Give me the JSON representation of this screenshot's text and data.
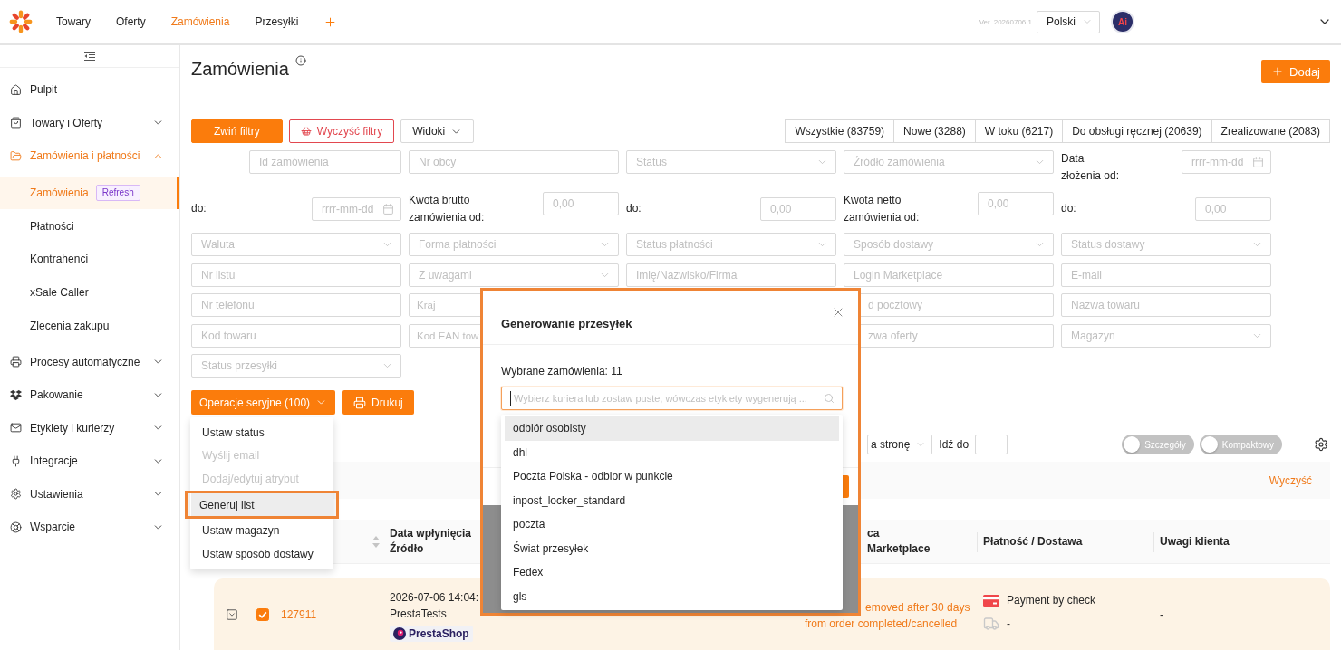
{
  "header": {
    "nav": [
      {
        "label": "Towary",
        "selected": false
      },
      {
        "label": "Oferty",
        "selected": false
      },
      {
        "label": "Zamówienia",
        "selected": true
      },
      {
        "label": "Przesyłki",
        "selected": false
      }
    ],
    "version": "Ver. 20260706.1",
    "language": "Polski",
    "avatar": "Ai"
  },
  "sidebar": {
    "items": [
      {
        "kind": "link",
        "label": "Pulpit"
      },
      {
        "kind": "group",
        "label": "Towary i Oferty",
        "expanded": false
      },
      {
        "kind": "group",
        "label": "Zamówienia i płatności",
        "expanded": true,
        "children": [
          {
            "label": "Zamówienia",
            "selected": true,
            "badge": "Refresh"
          },
          {
            "label": "Płatności",
            "selected": false
          },
          {
            "label": "Kontrahenci",
            "selected": false
          },
          {
            "label": "xSale Caller",
            "selected": false
          },
          {
            "label": "Zlecenia zakupu",
            "selected": false
          }
        ]
      },
      {
        "kind": "group",
        "label": "Procesy automatyczne",
        "expanded": false
      },
      {
        "kind": "group",
        "label": "Pakowanie",
        "expanded": false
      },
      {
        "kind": "group",
        "label": "Etykiety i kurierzy",
        "expanded": false
      },
      {
        "kind": "group",
        "label": "Integracje",
        "expanded": false
      },
      {
        "kind": "group",
        "label": "Ustawienia",
        "expanded": false
      },
      {
        "kind": "group",
        "label": "Wsparcie",
        "expanded": false
      }
    ]
  },
  "page": {
    "title": "Zamówienia",
    "add_button": "Dodaj"
  },
  "toolbar": {
    "buttons": [
      {
        "kind": "primary",
        "label": "Zwiń filtry"
      },
      {
        "kind": "danger",
        "label": "Wyczyść filtry"
      },
      {
        "kind": "dropdown",
        "label": "Widoki"
      }
    ],
    "status_tabs": [
      {
        "label": "Wszystkie (83759)",
        "selected": false
      },
      {
        "label": "Nowe (3288)",
        "selected": false
      },
      {
        "label": "W toku (6217)",
        "selected": false
      },
      {
        "label": "Do obsługi ręcznej (20639)",
        "selected": false
      },
      {
        "label": "Zrealizowane (2083)",
        "selected": false
      }
    ]
  },
  "filters": [
    {
      "kind": "input",
      "placeholder": "Id zamówienia"
    },
    {
      "kind": "input",
      "placeholder": "Nr obcy"
    },
    {
      "kind": "select",
      "placeholder": "Status"
    },
    {
      "kind": "select",
      "placeholder": "Źródło zamówienia"
    },
    {
      "kind": "date",
      "label": "Data złożenia od:",
      "placeholder": "rrrr-mm-dd"
    },
    {
      "kind": "date",
      "label": "do:",
      "placeholder": "rrrr-mm-dd"
    },
    {
      "kind": "number",
      "label": "Kwota brutto zamówienia od:",
      "placeholder": "0,00"
    },
    {
      "kind": "number",
      "label": "do:",
      "placeholder": "0,00"
    },
    {
      "kind": "number",
      "label": "Kwota netto zamówienia od:",
      "placeholder": "0,00"
    },
    {
      "kind": "number",
      "label": "do:",
      "placeholder": "0,00"
    },
    {
      "kind": "select",
      "placeholder": "Waluta"
    },
    {
      "kind": "select",
      "placeholder": "Forma płatności"
    },
    {
      "kind": "select",
      "placeholder": "Status płatności"
    },
    {
      "kind": "select",
      "placeholder": "Sposób dostawy"
    },
    {
      "kind": "select",
      "placeholder": "Status dostawy"
    },
    {
      "kind": "input",
      "placeholder": "Nr listu"
    },
    {
      "kind": "select",
      "placeholder": "Z uwagami"
    },
    {
      "kind": "input",
      "placeholder": "Imię/Nazwisko/Firma"
    },
    {
      "kind": "input",
      "placeholder": "Login Marketplace"
    },
    {
      "kind": "input",
      "placeholder": "E-mail"
    },
    {
      "kind": "input",
      "placeholder": "Nr telefonu"
    },
    {
      "kind": "clipped",
      "placeholder": "Kraj"
    },
    {
      "kind": "shifted",
      "placeholder": "d pocztowy"
    },
    {
      "kind": "input",
      "placeholder": "Nazwa towaru"
    },
    {
      "kind": "input",
      "placeholder": "Kod towaru"
    },
    {
      "kind": "clipped",
      "placeholder": "Kod EAN tow"
    },
    {
      "kind": "shifted",
      "placeholder": "zwa oferty"
    },
    {
      "kind": "select",
      "placeholder": "Magazyn"
    },
    {
      "kind": "select",
      "placeholder": "Status przesyłki"
    }
  ],
  "bulk_actions": {
    "button": "Operacje seryjne (100)",
    "print_button": "Drukuj",
    "menu": [
      {
        "label": "Ustaw status",
        "disabled": false,
        "selected": false,
        "framed": false
      },
      {
        "label": "Wyślij email",
        "disabled": true,
        "selected": false,
        "framed": false
      },
      {
        "label": "Dodaj/edytuj atrybut",
        "disabled": true,
        "selected": false,
        "framed": false
      },
      {
        "label": "Generuj list",
        "disabled": false,
        "selected": true,
        "framed": true
      },
      {
        "label": "Ustaw magazyn",
        "disabled": false,
        "selected": false,
        "framed": false
      },
      {
        "label": "Ustaw sposób dostawy",
        "disabled": false,
        "selected": false,
        "framed": false
      }
    ]
  },
  "pagination": {
    "page_size": "a stronę",
    "goto_label": "Idź do",
    "toggles": [
      {
        "label": "Szczegóły",
        "on": false
      },
      {
        "label": "Kompaktowy",
        "on": false
      }
    ]
  },
  "filter_summary": {
    "clear_link": "Wyczyść"
  },
  "table": {
    "columns": [
      {
        "sortable": true
      },
      {
        "lines": [
          "Data wpłynięcia",
          "Źródło"
        ],
        "sortable": false
      },
      {
        "lines": [
          "ca",
          "Marketplace"
        ],
        "sortable": false
      },
      {
        "lines": [
          "Płatność / Dostawa"
        ],
        "sortable": false
      },
      {
        "lines": [
          "Uwagi klienta"
        ],
        "sortable": false
      }
    ],
    "rows": [
      {
        "expanded": false,
        "checked": true,
        "order_id": "127911",
        "date": "2026-07-06 14:04:",
        "source": "PrestaTests",
        "source_logo": "PrestaShop",
        "notice_lines": [
          "emoved after 30 days",
          "from order completed/cancelled"
        ],
        "payment": "Payment by check",
        "delivery": "-",
        "customer_notes": "-"
      }
    ]
  },
  "modal": {
    "framed": true,
    "title": "Generowanie przesyłek",
    "selected_count": "Wybrane zamówienia: 11",
    "courier_select": {
      "placeholder": "Wybierz kuriera lub zostaw puste, wówczas etykiety wygenerują ...",
      "focused": true
    },
    "options": [
      {
        "label": "odbiór osobisty",
        "selected": true
      },
      {
        "label": "dhl",
        "selected": false
      },
      {
        "label": "Poczta Polska - odbior w punkcie",
        "selected": false
      },
      {
        "label": "inpost_locker_standard",
        "selected": false
      },
      {
        "label": "poczta",
        "selected": false
      },
      {
        "label": "Świat przesyłek",
        "selected": false
      },
      {
        "label": "Fedex",
        "selected": false
      },
      {
        "label": "gls",
        "selected": false
      }
    ]
  }
}
